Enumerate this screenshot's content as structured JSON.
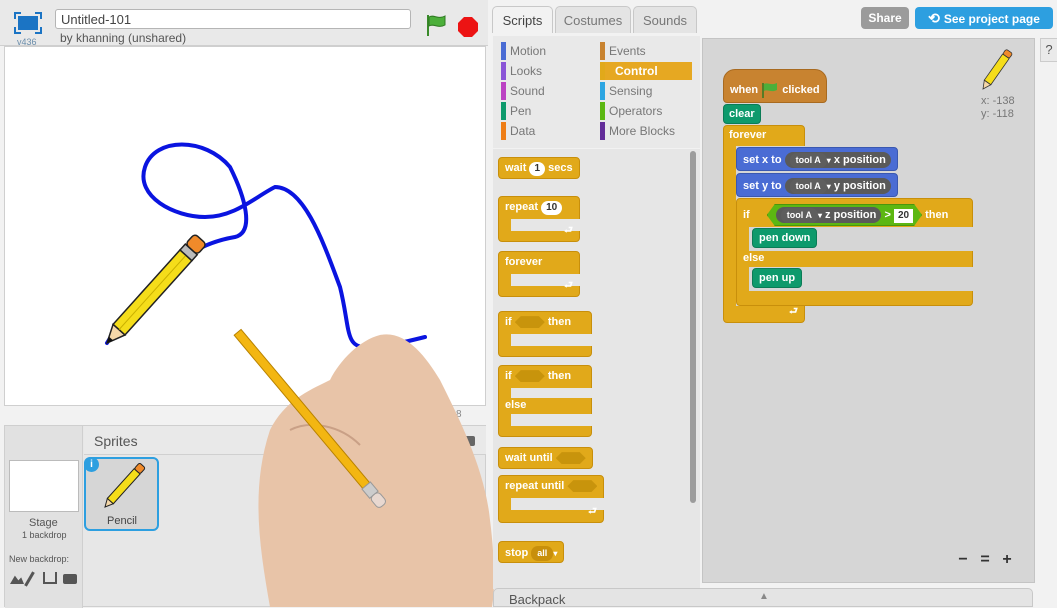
{
  "project": {
    "title": "Untitled-101",
    "byline": "by khanning (unshared)",
    "version": "v436"
  },
  "tabs": [
    "Scripts",
    "Costumes",
    "Sounds"
  ],
  "top_buttons": {
    "share": "Share",
    "see_project_page": "See project page"
  },
  "categories": [
    {
      "label": "Motion",
      "color": "#4a6cd4"
    },
    {
      "label": "Events",
      "color": "#c88330"
    },
    {
      "label": "Looks",
      "color": "#8a55d7"
    },
    {
      "label": "Control",
      "color": "#e1a91a"
    },
    {
      "label": "Sound",
      "color": "#bb42c3"
    },
    {
      "label": "Sensing",
      "color": "#2ca5e2"
    },
    {
      "label": "Pen",
      "color": "#0e9a6c"
    },
    {
      "label": "Operators",
      "color": "#5cb712"
    },
    {
      "label": "Data",
      "color": "#ee7d16"
    },
    {
      "label": "More Blocks",
      "color": "#632d99"
    }
  ],
  "palette": {
    "wait": "wait",
    "wait_value": "1",
    "secs": "secs",
    "repeat": "repeat",
    "repeat_value": "10",
    "forever": "forever",
    "if": "if",
    "then": "then",
    "if2": "if",
    "then2": "then",
    "else": "else",
    "wait_until": "wait until",
    "repeat_until": "repeat until",
    "stop": "stop",
    "stop_value": "all"
  },
  "script": {
    "when": "when",
    "clicked": "clicked",
    "clear": "clear",
    "forever": "forever",
    "set_x": "set",
    "x": "x",
    "to": "to",
    "tool_a": "tool A",
    "x_position": "x position",
    "set_y": "set",
    "y": "y",
    "to2": "to",
    "tool_a2": "tool A",
    "y_position": "y position",
    "if": "if",
    "tool_a3": "tool A",
    "z_position": "z position",
    "gt": ">",
    "threshold": "20",
    "then": "then",
    "pen_down": "pen down",
    "else": "else",
    "pen_up": "pen up"
  },
  "readout": {
    "x": "x: -138",
    "y": "y: -118"
  },
  "stage_coords": "8",
  "sprites": {
    "header": "Sprites",
    "stage_label": "Stage",
    "stage_sub": "1 backdrop",
    "new_backdrop": "New backdrop:",
    "selected_sprite": "Pencil"
  },
  "zoom": {
    "minus": "−",
    "equal": "=",
    "plus": "+"
  },
  "backpack": "Backpack",
  "colors": {
    "accent_blue": "#2d9fe0",
    "share_gray": "#9b9b9b",
    "stage_line": "#0a14e0"
  }
}
